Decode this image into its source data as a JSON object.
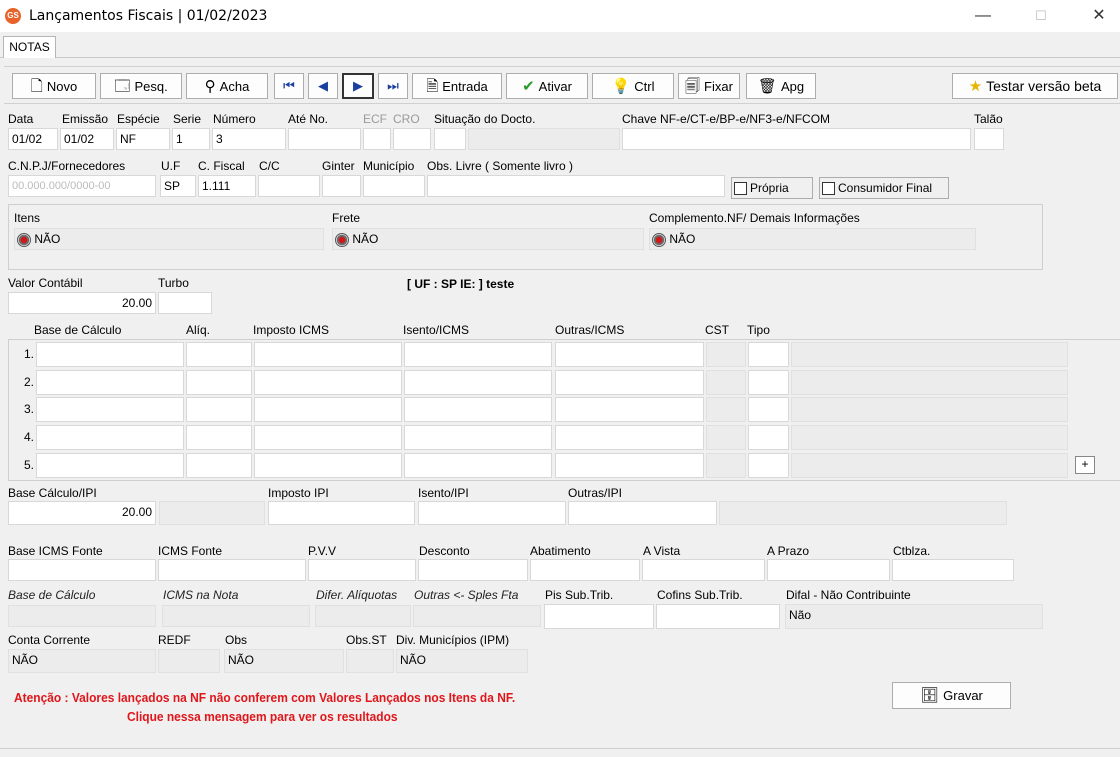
{
  "window": {
    "title": "Lançamentos Fiscais |  01/02/2023",
    "app_icon": "GS",
    "minimize": "—",
    "maximize": "☐",
    "close": "✕"
  },
  "tabs": [
    "NOTAS"
  ],
  "toolbar": {
    "novo": "Novo",
    "pesq": "Pesq.",
    "acha": "Acha",
    "first": "⏮",
    "prev": "◀",
    "next": "▶",
    "last": "⏭",
    "entrada": "Entrada",
    "ativar": "Ativar",
    "ctrl": "Ctrl",
    "fixar": "Fixar",
    "apg": "Apg",
    "testar": "Testar versão beta"
  },
  "header": {
    "labels": {
      "data": "Data",
      "emissao": "Emissão",
      "especie": "Espécie",
      "serie": "Serie",
      "numero": "Número",
      "ate_no": "Até No.",
      "ecf": "ECF",
      "cro": "CRO",
      "situacao": "Situação do Docto.",
      "chave": "Chave NF-e/CT-e/BP-e/NF3-e/NFCOM",
      "talao": "Talão"
    },
    "values": {
      "data": "01/02",
      "emissao": "01/02",
      "especie": "NF",
      "serie": "1",
      "numero": "3"
    }
  },
  "fornecedor": {
    "labels": {
      "cnpj": "C.N.P.J/Fornecedores",
      "uf": "U.F",
      "cfiscal": "C. Fiscal",
      "cc": "C/C",
      "ginter": "Ginter",
      "municipio": "Município",
      "obs_livre": "Obs. Livre ( Somente livro )"
    },
    "values": {
      "cnpj": "00.000.000/0000-00",
      "uf": "SP",
      "cfiscal": "1.111"
    },
    "propria": "Própria",
    "consumidor_final": "Consumidor Final"
  },
  "panel": {
    "itens_label": "Itens",
    "itens_value": "NÃO",
    "frete_label": "Frete",
    "frete_value": "NÃO",
    "complemento_label": "Complemento.NF/ Demais Informações",
    "complemento_value": "NÃO"
  },
  "valor": {
    "contabil_label": "Valor Contábil",
    "contabil_value": "20.00",
    "turbo_label": "Turbo",
    "uf_ie": "[ UF : SP IE:  ] teste"
  },
  "grid": {
    "headers": [
      "Base de Cálculo",
      "Alíq.",
      "Imposto ICMS",
      "Isento/ICMS",
      "Outras/ICMS",
      "CST",
      "Tipo"
    ],
    "rows": [
      "1.",
      "2.",
      "3.",
      "4.",
      "5."
    ],
    "plus": "+"
  },
  "ipi": {
    "base_label": "Base Cálculo/IPI",
    "base_value": "20.00",
    "imposto_label": "Imposto IPI",
    "isento_label": "Isento/IPI",
    "outras_label": "Outras/IPI"
  },
  "fonte": {
    "base_icms_fonte": "Base ICMS Fonte",
    "icms_fonte": "ICMS Fonte",
    "pvv": "P.V.V",
    "desconto": "Desconto",
    "abatimento": "Abatimento",
    "a_vista": "A Vista",
    "a_prazo": "A Prazo",
    "ctblza": "Ctblza."
  },
  "misc": {
    "base_calc": "Base de Cálculo",
    "icms_nota": "ICMS na Nota",
    "difer": "Difer. Alíquotas",
    "outras_sples": "Outras <- Sples Fta",
    "pis": "Pis Sub.Trib.",
    "cofins": "Cofins Sub.Trib.",
    "difal": "Difal - Não Contribuinte",
    "difal_value": "Não"
  },
  "bottom": {
    "conta_corrente": "Conta Corrente",
    "conta_value": "NÃO",
    "redf": "REDF",
    "obs": "Obs",
    "obs_value": "NÃO",
    "obs_st": "Obs.ST",
    "div_mun": "Div. Municípios (IPM)",
    "div_value": "NÃO"
  },
  "warning": {
    "line1": "Atenção : Valores lançados na NF não conferem com Valores Lançados nos Itens da NF.",
    "line2": "Clique nessa mensagem para ver os resultados"
  },
  "gravar": "Gravar",
  "colors": {
    "warning": "#e0161a",
    "accent": "#1a5fb4"
  }
}
